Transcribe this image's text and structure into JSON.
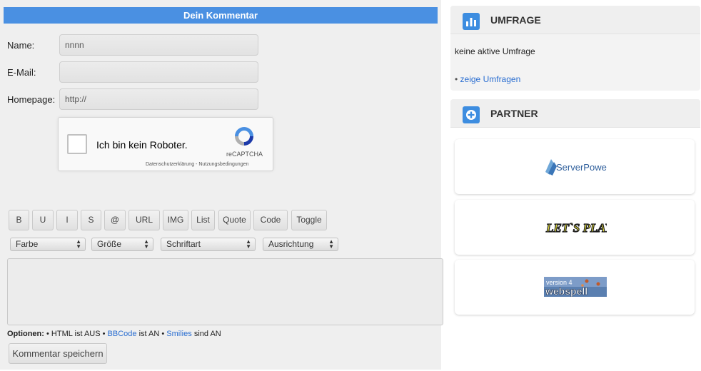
{
  "comment_form": {
    "header": "Dein Kommentar",
    "name_label": "Name:",
    "name_value": "nnnn",
    "email_label": "E-Mail:",
    "email_value": "",
    "homepage_label": "Homepage:",
    "homepage_value": "http://",
    "recaptcha": {
      "label": "Ich bin kein Roboter.",
      "brand": "reCAPTCHA",
      "links": "Datenschutzerklärung - Nutzungsbedingungen"
    },
    "bbcode_buttons": [
      "B",
      "U",
      "I",
      "S",
      "@",
      "URL",
      "IMG",
      "List",
      "Quote",
      "Code",
      "Toggle"
    ],
    "selects": [
      "Farbe",
      "Größe",
      "Schriftart",
      "Ausrichtung"
    ],
    "message_value": "",
    "options": {
      "prefix": "Optionen:",
      "html": "• HTML ist AUS •",
      "bbcode_link": "BBCode",
      "bbcode_state": "ist AN •",
      "smilies_link": "Smilies",
      "smilies_state": "sind AN"
    },
    "submit_label": "Kommentar speichern"
  },
  "sidebar": {
    "poll": {
      "title": "UMFRAGE",
      "no_poll_text": "keine aktive Umfrage",
      "bullet": "•",
      "link": "zeige Umfragen"
    },
    "partner": {
      "title": "PARTNER",
      "logos": [
        "ServerPower",
        "Let's Play",
        "webspell"
      ]
    }
  },
  "colors": {
    "header_blue": "#4a90e2",
    "link_blue": "#2a6ed1",
    "icon_blue": "#3d8de0"
  }
}
